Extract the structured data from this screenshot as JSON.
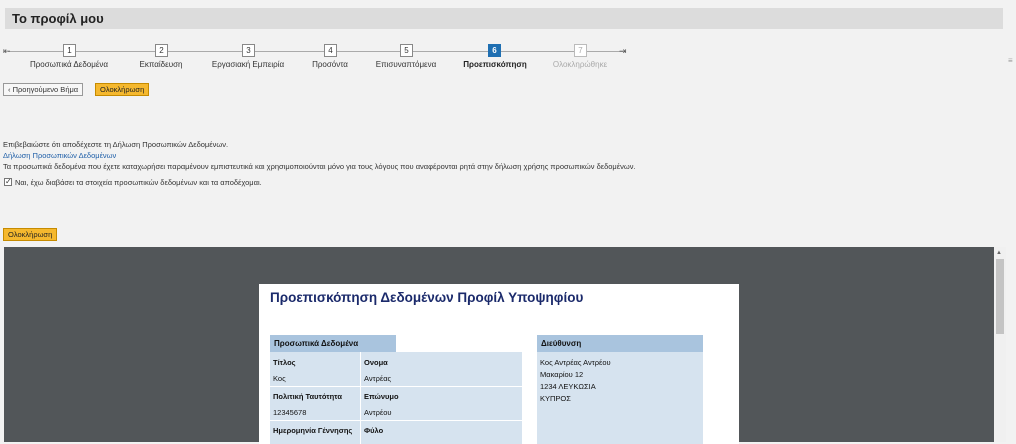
{
  "page": {
    "title": "Το προφίλ μου"
  },
  "stepper": {
    "steps": [
      {
        "number": "1",
        "label": "Προσωπικά Δεδομένα",
        "state": "done"
      },
      {
        "number": "2",
        "label": "Εκπαίδευση",
        "state": "done"
      },
      {
        "number": "3",
        "label": "Εργασιακή Εμπειρία",
        "state": "done"
      },
      {
        "number": "4",
        "label": "Προσόντα",
        "state": "done"
      },
      {
        "number": "5",
        "label": "Επισυναπτόμενα",
        "state": "done"
      },
      {
        "number": "6",
        "label": "Προεπισκόπηση",
        "state": "active"
      },
      {
        "number": "7",
        "label": "Ολοκληρώθηκε",
        "state": "disabled"
      }
    ]
  },
  "toolbar": {
    "prev_label": "Προηγούμενο Βήμα",
    "complete_label": "Ολοκλήρωση"
  },
  "consent": {
    "instruction": "Επιβεβαιώστε ότι αποδέχεστε τη Δήλωση Προσωπικών Δεδομένων.",
    "link_text": "Δήλωση Προσωπικών Δεδομένων",
    "notice": "Τα προσωπικά δεδομένα που έχετε καταχωρήσει παραμένουν εμπιστευτικά και χρησιμοποιούνται μόνο για τους λόγους που αναφέρονται ρητά στην δήλωση χρήσης προσωπικών δεδομένων.",
    "checkbox_label": "Ναι, έχω διαβάσει τα στοιχεία προσωπικών δεδομένων και τα αποδέχομαι.",
    "checked": true
  },
  "bottom_button": {
    "label": "Ολοκλήρωση"
  },
  "preview": {
    "title": "Προεπισκόπηση Δεδομένων Προφίλ Υποψηφίου",
    "personal": {
      "header": "Προσωπικά Δεδομένα",
      "rows": [
        {
          "l1": "Τίτλος",
          "l2": "Ονομα",
          "v1": "Κος",
          "v2": "Αντρέας"
        },
        {
          "l1": "Πολιτική Ταυτότητα",
          "l2": "Επώνυμο",
          "v1": "12345678",
          "v2": "Αντρέου"
        },
        {
          "l1": "Ημερομηνία Γέννησης",
          "l2": "Φύλο"
        }
      ]
    },
    "address": {
      "header": "Διεύθυνση",
      "lines": [
        "Κος Αντρέας Αντρέου",
        "Μακαρίου 12",
        "1234 ΛΕΥΚΩΣΙΑ",
        "ΚΥΠΡΟΣ"
      ]
    }
  }
}
